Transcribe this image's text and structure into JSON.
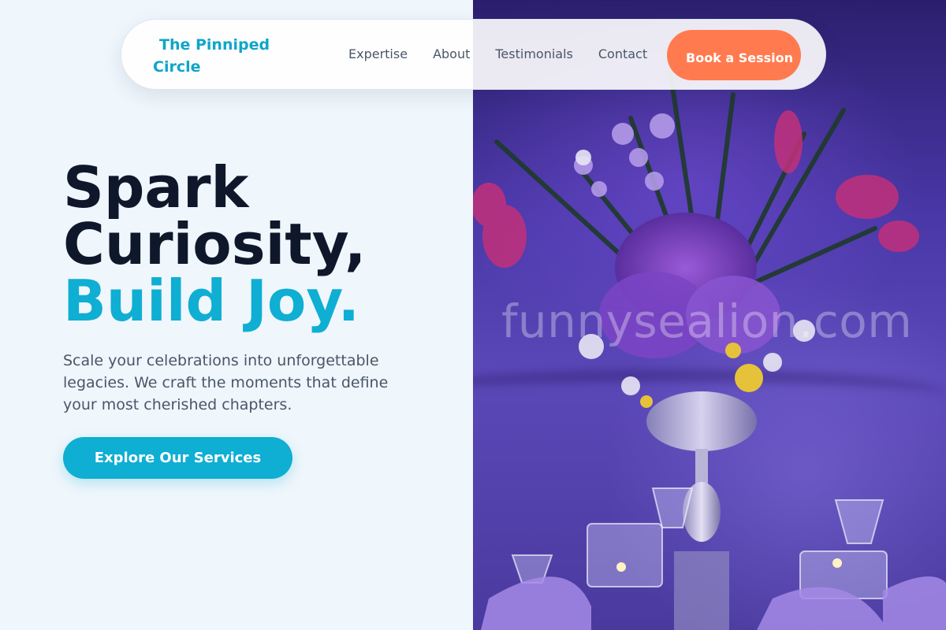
{
  "nav": {
    "brand": "The Pinniped Circle",
    "links": [
      "Expertise",
      "About",
      "Testimonials",
      "Contact"
    ],
    "cta": "Book a Session"
  },
  "hero": {
    "title_line1": "Spark",
    "title_line2": "Curiosity,",
    "title_accent": "Build Joy.",
    "subtitle": "Scale your celebrations into unforgettable legacies. We craft the moments that define your most cherished chapters.",
    "cta": "Explore Our Services"
  },
  "image": {
    "description_icon": "floral-centerpiece-photo",
    "watermark": "funnysealion.com"
  },
  "colors": {
    "brand": "#0fa6c8",
    "accent": "#0faed3",
    "cta_orange": "#ff7b4f",
    "heading": "#0f172a",
    "body_text": "#4a5668",
    "background": "#eff6fc"
  }
}
